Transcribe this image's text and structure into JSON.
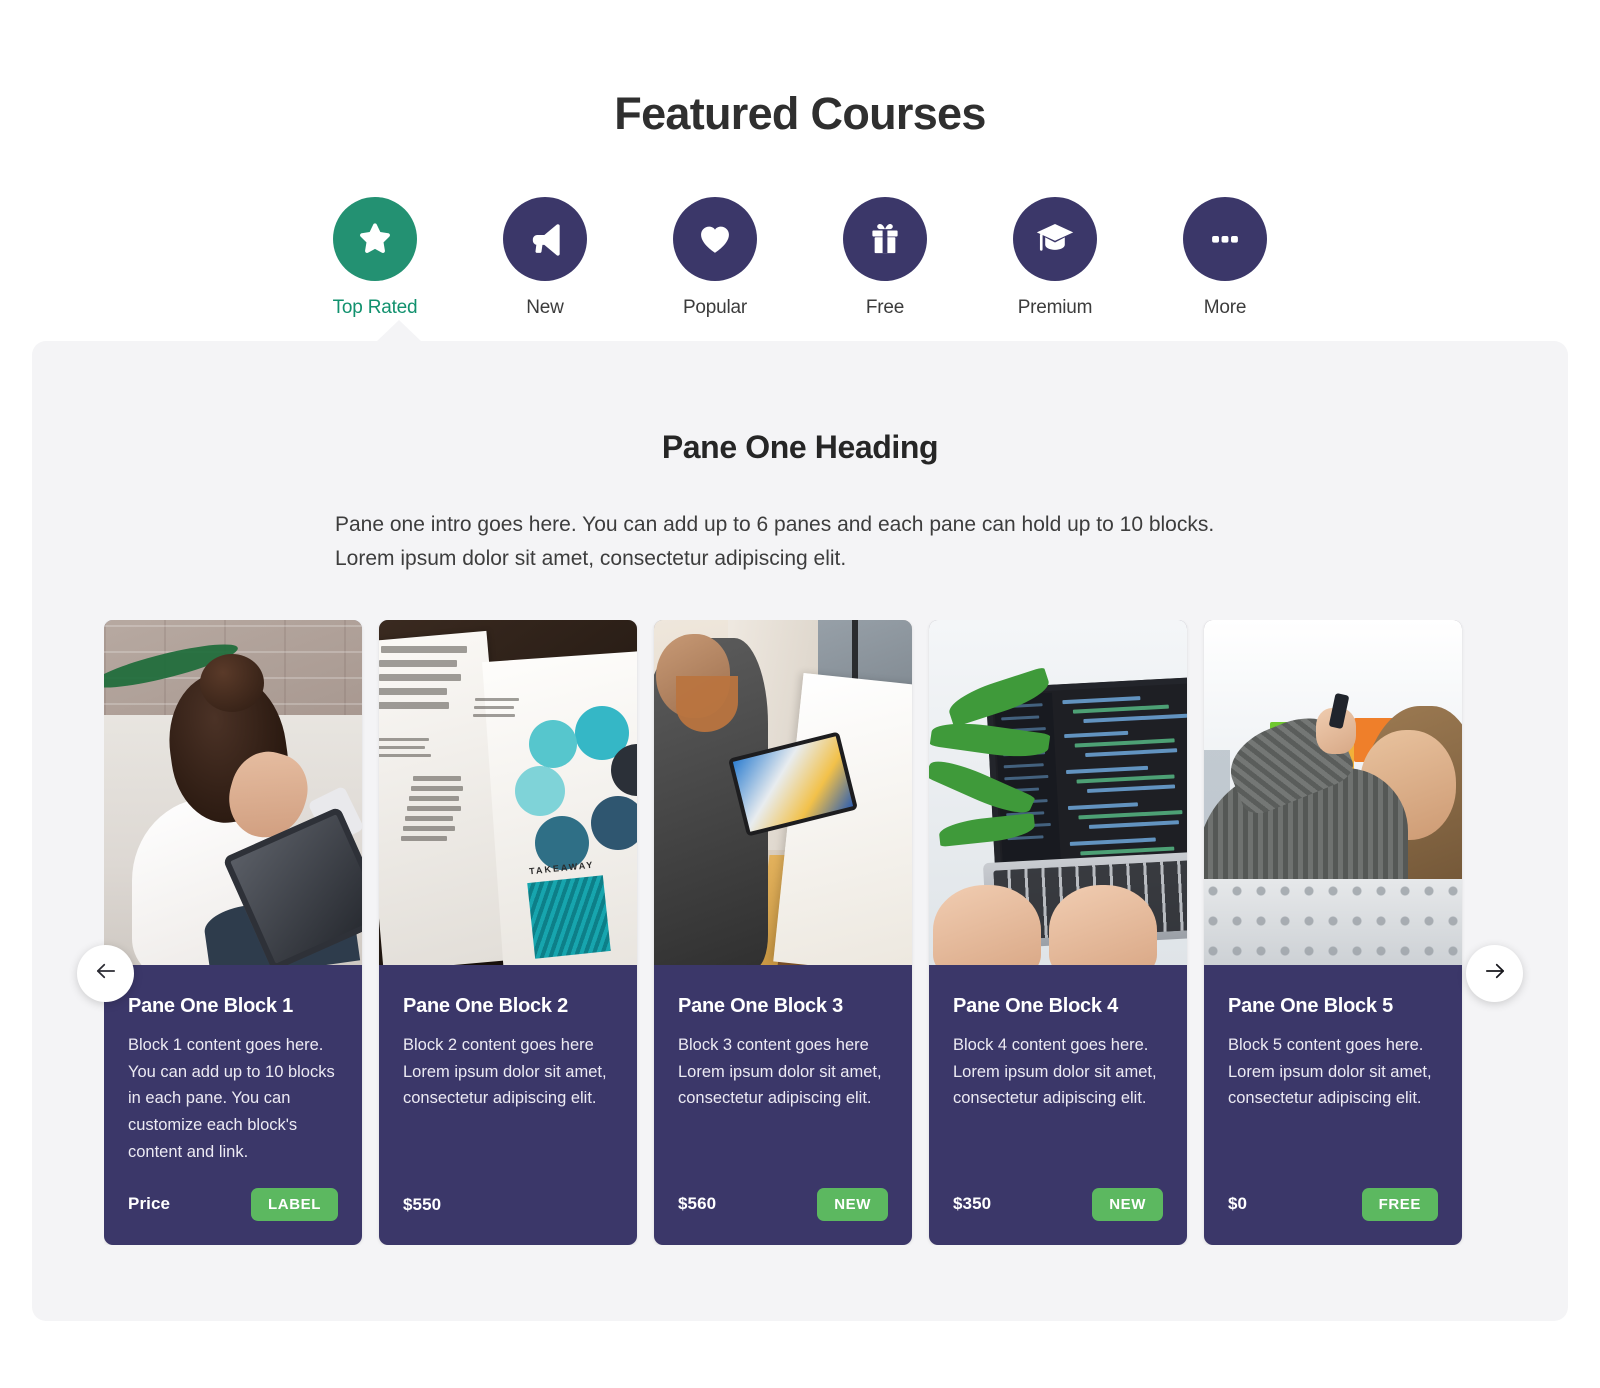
{
  "header": {
    "title": "Featured Courses"
  },
  "tabs": [
    {
      "label": "Top Rated",
      "icon": "star-icon",
      "active": true
    },
    {
      "label": "New",
      "icon": "megaphone-icon",
      "active": false
    },
    {
      "label": "Popular",
      "icon": "heart-icon",
      "active": false
    },
    {
      "label": "Free",
      "icon": "gift-icon",
      "active": false
    },
    {
      "label": "Premium",
      "icon": "graduation-cap-icon",
      "active": false
    },
    {
      "label": "More",
      "icon": "ellipsis-icon",
      "active": false
    }
  ],
  "panel": {
    "heading": "Pane One Heading",
    "intro": "Pane one intro goes here. You can add up to 6 panes and each pane can hold up to 10 blocks. Lorem ipsum dolor sit amet, consectetur adipiscing elit."
  },
  "carousel": {
    "prev_label": "←",
    "next_label": "→",
    "cards": [
      {
        "title": "Pane One Block 1",
        "text": "Block 1 content goes here. You can add up to 10 blocks in each pane. You can customize each block's content and link.",
        "price": "Price",
        "badge": "LABEL",
        "photo": "woman-drawing-on-tablet"
      },
      {
        "title": "Pane One Block 2",
        "text": "Block 2 content goes here Lorem ipsum dolor sit amet, consectetur adipiscing elit.",
        "price": "$550",
        "badge": "",
        "photo": "open-book-with-cycle-diagram"
      },
      {
        "title": "Pane One Block 3",
        "text": "Block 3 content goes here Lorem ipsum dolor sit amet, consectetur adipiscing elit.",
        "price": "$560",
        "badge": "NEW",
        "photo": "man-holding-tablet-by-easel"
      },
      {
        "title": "Pane One Block 4",
        "text": "Block 4 content goes here. Lorem ipsum dolor sit amet, consectetur adipiscing elit.",
        "price": "$350",
        "badge": "NEW",
        "photo": "hands-typing-on-laptop-code"
      },
      {
        "title": "Pane One Block 5",
        "text": "Block 5 content goes here. Lorem ipsum dolor sit amet, consectetur adipiscing elit.",
        "price": "$0",
        "badge": "FREE",
        "photo": "woman-with-sticky-notes-on-window"
      }
    ]
  },
  "colors": {
    "brand_purple": "#3b3769",
    "accent_green": "#11916e",
    "active_circle": "#239172",
    "badge_green": "#5cb860",
    "panel_bg": "#f4f4f6",
    "title_text": "#2f2f2f"
  }
}
